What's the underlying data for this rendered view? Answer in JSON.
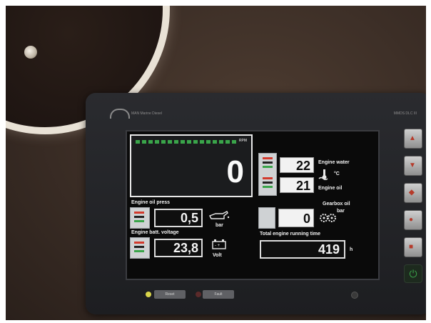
{
  "brand": "MAN Marine Diesel",
  "model": "MMDS DLC III",
  "rpm": {
    "label": "RPM",
    "value": "0"
  },
  "engine_water": {
    "label": "Engine water",
    "value": "22",
    "unit": "°C"
  },
  "engine_oil": {
    "label": "Engine oil",
    "value": "21"
  },
  "engine_oil_press": {
    "label": "Engine oil press",
    "value": "0,5",
    "unit": "bar"
  },
  "gearbox_oil": {
    "label": "Gearbox oil",
    "sublabel": "bar",
    "value": "0"
  },
  "engine_batt_voltage": {
    "label": "Engine batt. voltage",
    "value": "23,8",
    "unit": "Volt"
  },
  "total_running_time": {
    "label": "Total engine running time",
    "value": "419",
    "unit": "h"
  },
  "bottom_buttons": [
    "Reset",
    "Fault"
  ],
  "icons": [
    "temperature-icon",
    "oil-can-icon",
    "gears-icon",
    "battery-icon",
    "power-icon"
  ],
  "colors": {
    "led_green": "#3aa54a",
    "led_red": "#d23a2d",
    "power_green": "#3aa54a"
  }
}
